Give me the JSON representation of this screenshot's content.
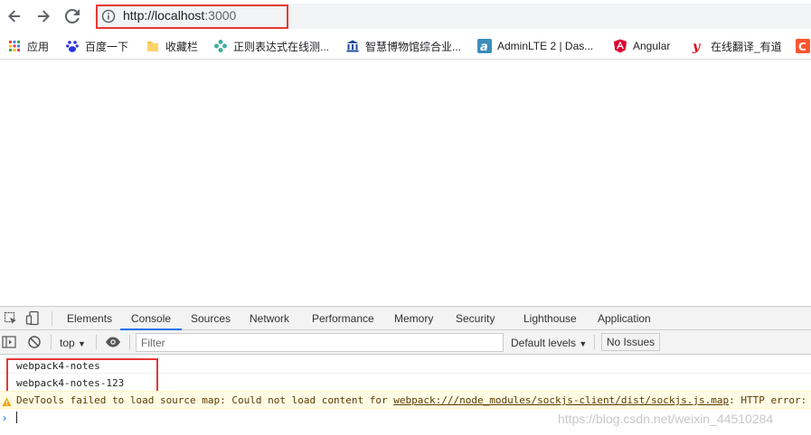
{
  "browser": {
    "url_host": "http://localhost",
    "url_port": ":3000"
  },
  "bookmarks": [
    {
      "label": "应用",
      "icon": "apps-grid-icon"
    },
    {
      "label": "百度一下",
      "icon": "baidu-paw-icon"
    },
    {
      "label": "收藏栏",
      "icon": "folder-icon"
    },
    {
      "label": "正则表达式在线测...",
      "icon": "gear-flower-icon"
    },
    {
      "label": "智慧博物馆综合业...",
      "icon": "museum-icon"
    },
    {
      "label": "AdminLTE 2 | Das...",
      "icon": "adminlte-logo-icon"
    },
    {
      "label": "Angular",
      "icon": "angular-logo-icon"
    },
    {
      "label": "在线翻译_有道",
      "icon": "youdao-logo-icon"
    }
  ],
  "devtools": {
    "tabs": [
      "Elements",
      "Console",
      "Sources",
      "Network",
      "Performance",
      "Memory",
      "Security",
      "Lighthouse",
      "Application"
    ],
    "active_tab": "Console",
    "context": "top",
    "filter_placeholder": "Filter",
    "levels": "Default levels",
    "issues": "No Issues"
  },
  "console": {
    "logs": [
      "webpack4-notes",
      "webpack4-notes-123"
    ],
    "warning_prefix": "DevTools failed to load source map: Could not load content for ",
    "warning_link": "webpack:///node_modules/sockjs-client/dist/sockjs.js.map",
    "warning_suffix": ": HTTP error: s",
    "prompt": "›",
    "watermark": "https://blog.csdn.net/weixin_44510284"
  },
  "colors": {
    "highlight": "#e53935",
    "accent": "#1a73e8"
  }
}
